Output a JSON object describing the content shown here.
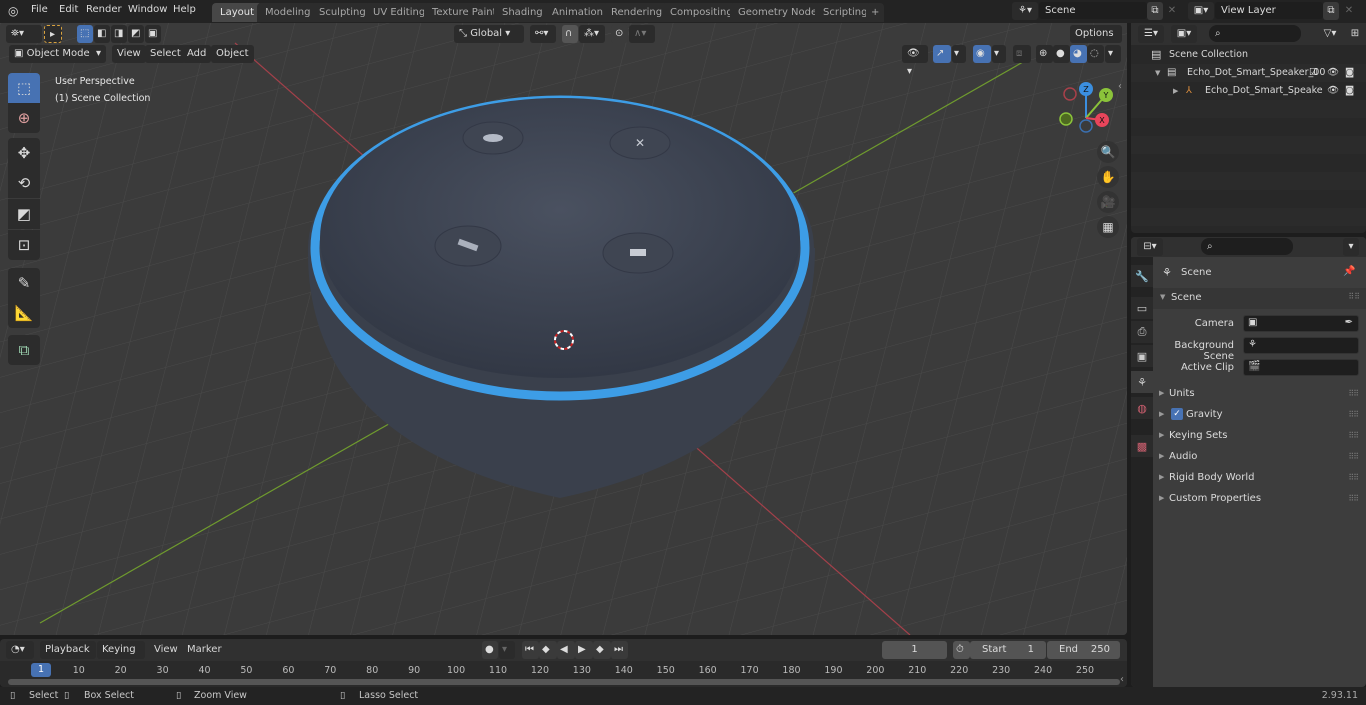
{
  "topbar": {
    "menus": [
      "File",
      "Edit",
      "Render",
      "Window",
      "Help"
    ],
    "workspaces": [
      "Layout",
      "Modeling",
      "Sculpting",
      "UV Editing",
      "Texture Paint",
      "Shading",
      "Animation",
      "Rendering",
      "Compositing",
      "Geometry Nodes",
      "Scripting"
    ],
    "active_workspace": "Layout",
    "add_workspace": "+",
    "scene_name": "Scene",
    "view_layer_name": "View Layer"
  },
  "viewport": {
    "mode": "Object Mode",
    "header_menus": [
      "View",
      "Select",
      "Add",
      "Object"
    ],
    "transform_orientation": "Global",
    "options_label": "Options",
    "overlay_line1": "User Perspective",
    "overlay_line2": "(1) Scene Collection",
    "gizmo_axes": {
      "x": "X",
      "y": "Y",
      "z": "Z"
    },
    "axis_colors": {
      "x": "#e8455b",
      "y": "#8bc33a",
      "z": "#3b8fe0"
    },
    "tools": [
      "select-box",
      "cursor",
      "move",
      "rotate",
      "scale",
      "transform",
      "annotate",
      "measure",
      "add-cube"
    ],
    "nav_buttons": [
      "zoom",
      "pan",
      "camera",
      "perspective"
    ]
  },
  "outliner": {
    "root": "Scene Collection",
    "items": [
      {
        "label": "Echo_Dot_Smart_Speaker_00",
        "type": "collection",
        "expanded": true,
        "checked": true
      },
      {
        "label": "Echo_Dot_Smart_Speake",
        "type": "object",
        "expanded": false
      }
    ]
  },
  "properties": {
    "context": "Scene",
    "section": "Scene",
    "fields": [
      {
        "label": "Camera",
        "value": ""
      },
      {
        "label": "Background Scene",
        "value": ""
      },
      {
        "label": "Active Clip",
        "value": ""
      }
    ],
    "panels": [
      {
        "label": "Units"
      },
      {
        "label": "Gravity",
        "checkbox": true
      },
      {
        "label": "Keying Sets"
      },
      {
        "label": "Audio"
      },
      {
        "label": "Rigid Body World"
      },
      {
        "label": "Custom Properties"
      }
    ]
  },
  "timeline": {
    "menus": [
      "Playback",
      "Keying",
      "View",
      "Marker"
    ],
    "current_frame": "1",
    "start_label": "Start",
    "start": "1",
    "end_label": "End",
    "end": "250",
    "ticks": [
      "1",
      "10",
      "20",
      "30",
      "40",
      "50",
      "60",
      "70",
      "80",
      "90",
      "100",
      "110",
      "120",
      "130",
      "140",
      "150",
      "160",
      "170",
      "180",
      "190",
      "200",
      "210",
      "220",
      "230",
      "240",
      "250"
    ]
  },
  "statusbar": {
    "hints": [
      "Select",
      "Box Select",
      "Zoom View",
      "Lasso Select"
    ],
    "version": "2.93.11"
  }
}
